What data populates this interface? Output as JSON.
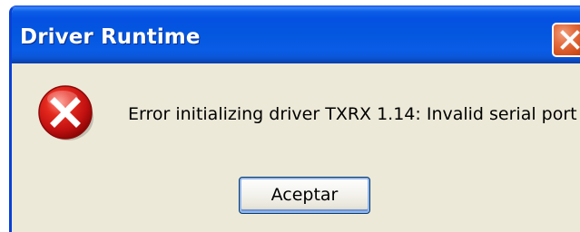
{
  "window": {
    "title": "Driver Runtime",
    "close_icon": "close-icon"
  },
  "dialog": {
    "icon": "error-icon",
    "message": "Error initializing driver TXRX 1.14: Invalid serial port",
    "ok_label": "Aceptar"
  },
  "colors": {
    "titlebar": "#0457df",
    "body": "#ece9d8",
    "close_button": "#d4521f",
    "error_icon": "#c81010"
  }
}
